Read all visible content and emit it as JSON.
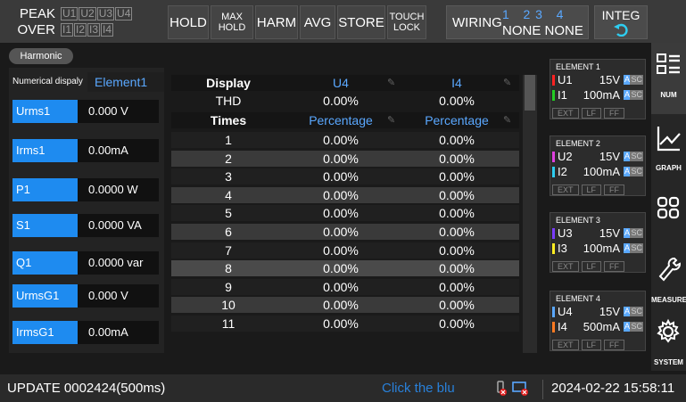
{
  "top": {
    "peak_label": "PEAK",
    "over_label": "OVER",
    "peak_channels": [
      "U1",
      "U2",
      "U3",
      "U4"
    ],
    "over_channels": [
      "I1",
      "I2",
      "I3",
      "I4"
    ],
    "hold": "HOLD",
    "max_hold": [
      "MAX",
      "HOLD"
    ],
    "harm": "HARM",
    "avg": "AVG",
    "store": "STORE",
    "touch_lock": [
      "TOUCH",
      "LOCK"
    ],
    "wiring_label": "WIRING",
    "wiring_numbers": "1   2 3   4",
    "wiring_values": "NONE NONE",
    "integ_label": "INTEG",
    "integ_icon": "reset-arrow-icon"
  },
  "left": {
    "tab": "Harmonic",
    "numdisp_label": "Numerical dispaly",
    "element_selected": "Element1",
    "measurements": [
      {
        "name": "Urms1",
        "value": "0.000 V"
      },
      {
        "name": "Irms1",
        "value": "0.00mA"
      },
      {
        "name": "P1",
        "value": "0.0000 W"
      },
      {
        "name": "S1",
        "value": "0.0000 VA"
      },
      {
        "name": "Q1",
        "value": "0.0000 var"
      },
      {
        "name": "UrmsG1",
        "value": "0.000 V"
      },
      {
        "name": "IrmsG1",
        "value": "0.00mA"
      }
    ]
  },
  "table": {
    "display_label": "Display",
    "col2_header": "U4",
    "col3_header": "I4",
    "thd_label": "THD",
    "thd_u": "0.00%",
    "thd_i": "0.00%",
    "times_label": "Times",
    "col2_sub": "Percentage",
    "col3_sub": "Percentage",
    "rows": [
      {
        "n": "1",
        "u": "0.00%",
        "i": "0.00%"
      },
      {
        "n": "2",
        "u": "0.00%",
        "i": "0.00%"
      },
      {
        "n": "3",
        "u": "0.00%",
        "i": "0.00%"
      },
      {
        "n": "4",
        "u": "0.00%",
        "i": "0.00%"
      },
      {
        "n": "5",
        "u": "0.00%",
        "i": "0.00%"
      },
      {
        "n": "6",
        "u": "0.00%",
        "i": "0.00%"
      },
      {
        "n": "7",
        "u": "0.00%",
        "i": "0.00%"
      },
      {
        "n": "8",
        "u": "0.00%",
        "i": "0.00%"
      },
      {
        "n": "9",
        "u": "0.00%",
        "i": "0.00%"
      },
      {
        "n": "10",
        "u": "0.00%",
        "i": "0.00%"
      },
      {
        "n": "11",
        "u": "0.00%",
        "i": "0.00%"
      }
    ]
  },
  "elements": [
    {
      "title": "ELEMENT 1",
      "u": "U1",
      "u_range": "15V",
      "i": "I1",
      "i_range": "100mA",
      "u_color": "#ff2222",
      "i_color": "#22cc22"
    },
    {
      "title": "ELEMENT 2",
      "u": "U2",
      "u_range": "15V",
      "i": "I2",
      "i_range": "100mA",
      "u_color": "#e040e0",
      "i_color": "#2ecdf0"
    },
    {
      "title": "ELEMENT 3",
      "u": "U3",
      "u_range": "15V",
      "i": "I3",
      "i_range": "100mA",
      "u_color": "#7a3cff",
      "i_color": "#ffee22"
    },
    {
      "title": "ELEMENT 4",
      "u": "U4",
      "u_range": "15V",
      "i": "I4",
      "i_range": "500mA",
      "u_color": "#5aa8ff",
      "i_color": "#ff7a22"
    }
  ],
  "element_tags": {
    "a": "A",
    "sc": "SC",
    "ext": "EXT",
    "lf": "LF",
    "ff": "FF"
  },
  "nav": [
    {
      "label": "NUM",
      "icon": "list-icon"
    },
    {
      "label": "GRAPH",
      "icon": "graph-icon"
    },
    {
      "label": "",
      "icon": "grid-icon"
    },
    {
      "label": "MEASURE",
      "icon": "wrench-icon"
    },
    {
      "label": "SYSTEM",
      "icon": "gear-icon"
    }
  ],
  "status": {
    "update": "UPDATE 0002424(500ms)",
    "hint": "Click the blu",
    "datetime": "2024-02-22 15:58:11"
  },
  "colors": {
    "accent": "#1e8bf0",
    "hint": "#2980d9",
    "table_header": "#5aa8ff"
  }
}
